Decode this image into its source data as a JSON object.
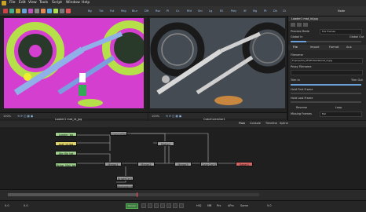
{
  "menu": [
    "File",
    "Edit",
    "View",
    "Tools",
    "Script",
    "Window",
    "Help"
  ],
  "toolbar": {
    "labels": [
      "Bg",
      "Txt",
      "Fst",
      "Mrg",
      "Blur",
      "Dft",
      "Rsz",
      "Pl",
      "Cc",
      "Rfd",
      "Sm",
      "Lg",
      "Ell",
      "Poly",
      "Xf",
      "Mg",
      "Pt",
      "Dk",
      "Ct"
    ],
    "right_labels": [
      "Node"
    ]
  },
  "viewer_left": {
    "zoom": "100%",
    "label": "Loader1 mat_id_jpg"
  },
  "viewer_right": {
    "zoom": "100%",
    "label": "ColorCorrector1"
  },
  "inspector": {
    "header": "Loader1 mat_id.jpg",
    "tabs": [
      "File",
      "Import",
      "Format",
      "Aux"
    ],
    "rows": [
      {
        "label": "Process Mode",
        "value": "Full Frames"
      },
      {
        "label": "Global In",
        "value": "0"
      },
      {
        "label": "Global Out",
        "value": "5"
      },
      {
        "label": "Filename",
        "value": "E:\\projects\\_SF\\Whiteside\\mat_id.jpg"
      },
      {
        "label": "Proxy Filename",
        "value": ""
      },
      {
        "label": "Trim In",
        "value": "0"
      },
      {
        "label": "Trim Out",
        "value": "0"
      },
      {
        "label": "Hold First Frame",
        "value": "0"
      },
      {
        "label": "Hold Last Frame",
        "value": "0"
      },
      {
        "label": "Reverse",
        "value": ""
      },
      {
        "label": "Loop",
        "value": ""
      },
      {
        "label": "Missing Frames",
        "value": "Fail"
      }
    ]
  },
  "flow": {
    "tabs": [
      "Flow",
      "Console",
      "Timeline",
      "Spline"
    ],
    "nodes": [
      {
        "id": "n1",
        "label": "Loader_bg"
      },
      {
        "id": "n2",
        "label": "mat_id.jpg"
      },
      {
        "id": "n3",
        "label": "Ato_Bk_tot"
      },
      {
        "id": "n4",
        "label": "Bckgr_Mat_tot"
      },
      {
        "id": "n5",
        "label": "ChannelBools1"
      },
      {
        "id": "n6",
        "label": "Merge1"
      },
      {
        "id": "n7",
        "label": "Merge2"
      },
      {
        "id": "n8",
        "label": "Merge3"
      },
      {
        "id": "n9",
        "label": "Matte1"
      },
      {
        "id": "n10",
        "label": "ColorCorr1"
      },
      {
        "id": "n11",
        "label": "Saver1"
      },
      {
        "id": "n12",
        "label": "BrightCtr1"
      },
      {
        "id": "n13",
        "label": "Background1"
      }
    ]
  },
  "timeline": {
    "start": "0.0",
    "end": "5.0",
    "current": "0.0",
    "render_label": "Render",
    "buttons": [
      "HiQ",
      "MB",
      "Prx",
      "APrx",
      "Some"
    ]
  },
  "colors": {
    "magenta": "#d53fcf",
    "lime": "#b6e04a",
    "accent": "#c8a22a"
  }
}
